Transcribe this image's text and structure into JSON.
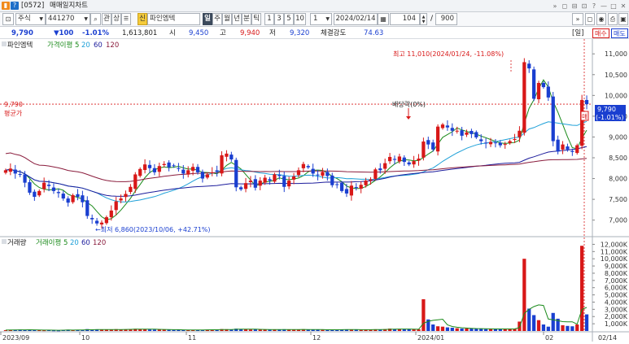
{
  "window": {
    "code": "[0572]",
    "title": "매매일지차트",
    "controls": [
      "»",
      "◻",
      "⊟",
      "⊡",
      "?",
      "—",
      "□",
      "✕"
    ]
  },
  "toolbar": {
    "market": "주식",
    "symbol": "441270",
    "btn_gwan": "관",
    "btn_sang": "상",
    "btn_sin": "신",
    "stock_name": "파인엠텍",
    "periods": [
      "일",
      "주",
      "월",
      "년",
      "분",
      "틱"
    ],
    "selected_period": "일",
    "intervals": [
      "1",
      "3",
      "5",
      "10"
    ],
    "interval_value": "1",
    "date": "2024/02/14",
    "count": "104",
    "total": "900"
  },
  "quote": {
    "price": "9,790",
    "change": "▼100",
    "change_pct": "-1.01%",
    "volume": "1,613,801",
    "open_label": "시",
    "open": "9,450",
    "high_label": "고",
    "high": "9,940",
    "low_label": "저",
    "low": "9,320",
    "strength_label": "체결강도",
    "strength": "74.63",
    "period_tag": "[일]",
    "buy_label": "매수",
    "sell_label": "매도"
  },
  "price_panel": {
    "title": "파인엠텍",
    "ma_label": "가격이평",
    "ma_list": [
      "5",
      "20",
      "60",
      "120"
    ],
    "ma_colors": [
      "#1a8a1a",
      "#1ea0d8",
      "#1c1c9c",
      "#8a1c3c"
    ],
    "high_note": "최고 11,010(2024/01/24, -11.08%)",
    "low_note": "←최저 6,860(2023/10/06, +42.71%)",
    "dividend_note": "배당락(0%)",
    "avg_label_value": "9,790",
    "avg_label_text": "평균가",
    "current_tag_price": "9,790",
    "current_tag_change": "(-1.01%)",
    "sell_marker": "매"
  },
  "volume_panel": {
    "title": "거래량",
    "ma_label": "거래이평",
    "ma_list": [
      "5",
      "20",
      "60",
      "120"
    ]
  },
  "x_axis": [
    "2023/09",
    "10",
    "11",
    "12",
    "2024/01",
    "02",
    "02/14"
  ],
  "chart_data": {
    "type": "candlestick",
    "price_axis_ticks": [
      11000,
      10500,
      10000,
      9500,
      9000,
      8500,
      8000,
      7500,
      7000
    ],
    "price_axis_labels": [
      "11,000",
      "10,500",
      "10,000",
      "9,500",
      "9,000",
      "8,500",
      "8,000",
      "7,500",
      "7,000"
    ],
    "volume_axis_ticks": [
      12000,
      11000,
      10000,
      9000,
      8000,
      7000,
      6000,
      5000,
      4000,
      3000,
      2000,
      1000
    ],
    "volume_axis_labels": [
      "12,000K",
      "11,000K",
      "10,000K",
      "9,000K",
      "8,000K",
      "7,000K",
      "6,000K",
      "5,000K",
      "4,000K",
      "3,000K",
      "2,000K",
      "1,000K"
    ],
    "price_range": [
      6700,
      11200
    ],
    "volume_range": [
      0,
      12500
    ],
    "average_price": 9790,
    "high": {
      "price": 11010,
      "date": "2024/01/24"
    },
    "low": {
      "price": 6860,
      "date": "2023/10/06"
    },
    "closes": [
      8200,
      8240,
      8120,
      8100,
      7900,
      7660,
      7560,
      7700,
      7900,
      7820,
      7700,
      7650,
      7520,
      7420,
      7600,
      7560,
      7430,
      7100,
      7020,
      6920,
      6940,
      7070,
      7230,
      7450,
      7520,
      7630,
      7800,
      8100,
      8230,
      8340,
      8250,
      8150,
      8300,
      8350,
      8270,
      8300,
      8250,
      8120,
      8200,
      8280,
      8150,
      8000,
      8100,
      8150,
      8170,
      8560,
      8600,
      8460,
      7790,
      7740,
      7890,
      7950,
      7780,
      7950,
      8020,
      7950,
      8100,
      8060,
      7800,
      7950,
      8050,
      8200,
      8350,
      8270,
      8120,
      8080,
      8160,
      8060,
      7840,
      7860,
      7700,
      7640,
      7830,
      7780,
      7850,
      7950,
      7980,
      8220,
      8200,
      8370,
      8520,
      8450,
      8530,
      8400,
      8340,
      8420,
      8480,
      8890,
      8820,
      8700,
      9250,
      9300,
      9230,
      9150,
      9150,
      9030,
      9110,
      9070,
      8990,
      8900,
      8850,
      8880,
      8860,
      8800,
      8830,
      8900,
      8950,
      9150,
      10800,
      10650,
      9920,
      10300,
      10200,
      9950,
      8900,
      8650,
      8820,
      8700,
      8640,
      8800,
      9890,
      9790
    ],
    "volumes": [
      120,
      150,
      180,
      200,
      140,
      160,
      130,
      110,
      100,
      140,
      90,
      80,
      160,
      180,
      120,
      130,
      150,
      260,
      200,
      190,
      170,
      180,
      210,
      250,
      220,
      190,
      260,
      300,
      280,
      240,
      210,
      200,
      220,
      180,
      160,
      150,
      170,
      140,
      130,
      160,
      150,
      170,
      190,
      180,
      160,
      260,
      240,
      200,
      320,
      280,
      230,
      210,
      220,
      200,
      190,
      180,
      200,
      190,
      240,
      200,
      180,
      220,
      240,
      200,
      180,
      170,
      160,
      150,
      190,
      180,
      210,
      200,
      180,
      170,
      160,
      180,
      190,
      230,
      210,
      250,
      330,
      280,
      260,
      240,
      230,
      220,
      240,
      4400,
      1600,
      900,
      650,
      600,
      500,
      450,
      380,
      340,
      360,
      330,
      300,
      280,
      260,
      270,
      290,
      300,
      280,
      260,
      300,
      1300,
      10000,
      3100,
      2200,
      1500,
      900,
      600,
      2500,
      1700,
      800,
      700,
      650,
      900,
      11800,
      2300
    ],
    "series": [
      {
        "name": "가격이평 5"
      },
      {
        "name": "가격이평 20"
      },
      {
        "name": "가격이평 60"
      },
      {
        "name": "가격이평 120"
      },
      {
        "name": "거래이평 5"
      }
    ]
  }
}
